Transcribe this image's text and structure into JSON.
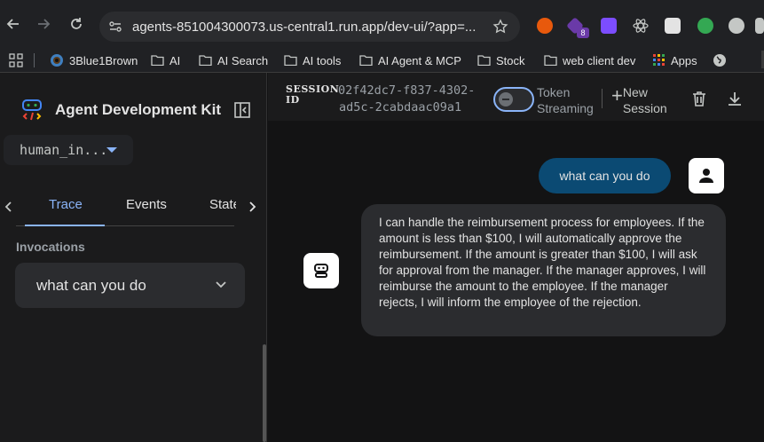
{
  "browser": {
    "url": "agents-851004300073.us-central1.run.app/dev-ui/?app=...",
    "extension_badge": "8",
    "bookmarks": [
      {
        "label": "3Blue1Brown",
        "icon": "3b1b-icon"
      },
      {
        "label": "AI",
        "icon": "folder-icon"
      },
      {
        "label": "AI Search",
        "icon": "folder-icon"
      },
      {
        "label": "AI tools",
        "icon": "folder-icon"
      },
      {
        "label": "AI Agent & MCP",
        "icon": "folder-icon"
      },
      {
        "label": "Stock",
        "icon": "folder-icon"
      },
      {
        "label": "web client dev",
        "icon": "folder-icon"
      },
      {
        "label": "Apps",
        "icon": "apps-grid-icon"
      }
    ]
  },
  "sidebar": {
    "title": "Agent Development Kit",
    "app_select_value": "human_in...",
    "tabs": [
      {
        "label": "Trace",
        "active": true
      },
      {
        "label": "Events",
        "active": false
      },
      {
        "label": "State",
        "active": false
      }
    ],
    "invocations_label": "Invocations",
    "invocation_item": "what can you do"
  },
  "session": {
    "label_line1": "SESSION",
    "label_line2": "ID",
    "id_line1": "02f42dc7-f837-4302-",
    "id_line2": "ad5c-2cabdaac09a1",
    "toggle_label_line1": "Token",
    "toggle_label_line2": "Streaming",
    "token_streaming_on": false,
    "new_session_line1": "New",
    "new_session_line2": "Session"
  },
  "chat": {
    "user_message": "what can you do",
    "bot_message": "I can handle the reimbursement process for employees. If the amount is less than $100, I will automatically approve the reimbursement. If the amount is greater than $100, I will ask for approval from the manager. If the manager approves, I will reimburse the amount to the employee. If the manager rejects, I will inform the employee of the rejection."
  },
  "colors": {
    "accent": "#8ab4f8",
    "user_bubble": "#0b4a73",
    "bot_bubble": "#2b2c2f"
  }
}
